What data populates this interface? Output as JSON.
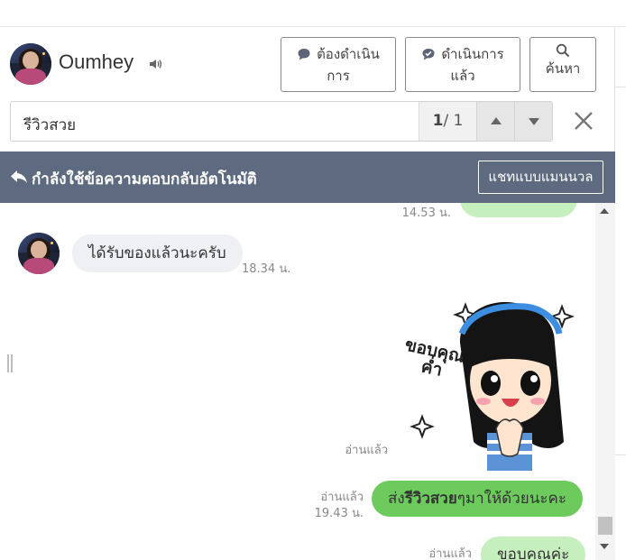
{
  "header": {
    "contact_name": "Oumhey",
    "buttons": [
      {
        "label_line1": "ต้องดำเนิน",
        "label_line2": "การ",
        "icon": "chat-bubble-icon"
      },
      {
        "label_line1": "ดำเนินการ",
        "label_line2": "แล้ว",
        "icon": "check-bubble-icon"
      },
      {
        "label_line1": "",
        "label_line2": "ค้นหา",
        "icon": "search-icon"
      }
    ]
  },
  "search": {
    "query": "รีวิวสวย",
    "current": "1",
    "total": "/ 1"
  },
  "auto_reply": {
    "text": "กำลังใช้ข้อความตอบกลับอัตโนมัติ",
    "manual_button": "แชทแบบแมนนวล"
  },
  "messages": {
    "top_time": "14.53 น.",
    "incoming_text": "ได้รับของแล้วนะครับ",
    "incoming_time": "18.34 น.",
    "sticker_read": "อ่านแล้ว",
    "sticker_text_line1": "ขอบคุณ",
    "sticker_text_line2": "ค่ำ",
    "msg2_read": "อ่านแล้ว",
    "msg2_time": "19.43 น.",
    "msg2_before": "ส่ง",
    "msg2_highlight": "รีวิวสวย",
    "msg2_after": "ๆมาให้ด้วยนะคะ",
    "msg3_read": "อ่านแล้ว",
    "msg3_text": "ขอบคุณค่ะ"
  },
  "colors": {
    "auto_bar": "#5d6a80",
    "outgoing_bubble": "#6dcb5d",
    "incoming_bubble": "#eef0f3"
  }
}
